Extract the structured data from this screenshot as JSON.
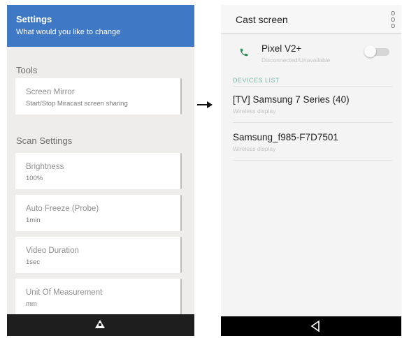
{
  "left": {
    "header": {
      "title": "Settings",
      "subtitle": "What would you like to change"
    },
    "sections": [
      {
        "title": "Tools",
        "items": [
          {
            "title": "Screen Mirror",
            "subtitle": "Start/Stop Miracast screen sharing"
          }
        ]
      },
      {
        "title": "Scan Settings",
        "items": [
          {
            "title": "Brightness",
            "subtitle": "100%"
          },
          {
            "title": "Auto Freeze (Probe)",
            "subtitle": "1min"
          },
          {
            "title": "Video Duration",
            "subtitle": "1sec"
          },
          {
            "title": "Unit Of Measurement",
            "subtitle": "mm"
          }
        ]
      }
    ],
    "nav": {
      "icon": "home-triangle-icon"
    }
  },
  "right": {
    "header": {
      "title": "Cast screen",
      "menu_icon": "more-vert-icon"
    },
    "current_device": {
      "name": "Pixel V2+",
      "status": "Disconnected/Unavailable",
      "toggle_on": false,
      "icon": "phone-icon"
    },
    "devices_list_label": "DEVICES LIST",
    "devices": [
      {
        "name": "[TV] Samsung 7 Series (40)",
        "type": "Wireless display"
      },
      {
        "name": "Samsung_f985-F7D7501",
        "type": "Wireless display"
      }
    ],
    "nav": {
      "icon": "back-icon"
    }
  },
  "colors": {
    "header_blue": "#3f78c4",
    "accent_green": "#2e8b57"
  }
}
